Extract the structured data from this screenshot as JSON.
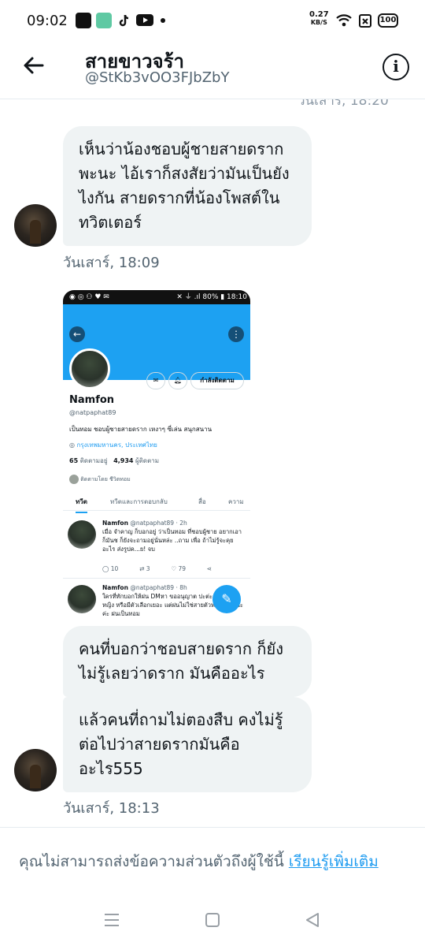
{
  "status_bar": {
    "time": "09:02",
    "speed_value": "0.27",
    "speed_unit": "KB/S",
    "battery": "100"
  },
  "header": {
    "title": "สายขาวจร้า",
    "handle": "@StKb3vOO3FJbZbY",
    "peek_time": "วันเสาร์, 18:20"
  },
  "messages": [
    {
      "text": "เห็นว่าน้องชอบผู้ชายสายดราก พะนะ ไอ้เราก็สงสัยว่ามันเป็นยังไงกัน สายดรากที่น้องโพสต์ในทวิตเตอร์",
      "timestamp": "วันเสาร์, 18:09"
    },
    {
      "text": "คนที่บอกว่าชอบสายดราก ก็ยังไม่รู้เลยว่าดราก มันคืออะไร"
    },
    {
      "text": "แล้วคนที่ถามไม่ตองสืบ คงไม่รู้ต่อไปว่าสายดรากมันคืออะไร555",
      "timestamp": "วันเสาร์, 18:13"
    }
  ],
  "embedded_screenshot": {
    "status_left": "◉ ◎ ⚇ ♥ ✉",
    "status_right": "✕ ⏚ .ıl 80% ▮ 18:10",
    "following_button": "กำลังติดตาม",
    "name": "Namfon",
    "handle": "@natpaphat89",
    "bio": "เป็นทอม ชอบผู้ชายสายดราก เหงาๆ ซี่เล่น สนุกสนาน",
    "location": "กรุงเทพมหานคร, ประเทศไทย",
    "following_count": "65",
    "following_label": "ติดตามอยู่",
    "followers_count": "4,934",
    "followers_label": "ผู้ติดตาม",
    "followed_by": "ติดตามโดย ชีวิตทอม",
    "tabs": [
      "ทวีต",
      "ทวีตและการตอบกลับ",
      "สื่อ",
      "ความ"
    ],
    "tweets": [
      {
        "author": "Namfon",
        "meta": "@natpaphat89 · 2h",
        "text": "เมื่อ จำคาญ ก็บอกอยู่ ว่าเป็นทอม ที่ชอบผู้ชาย อยากเอาก็มันช ก็ยังจะถามอยู่นั่นหล่ะ ..ถาม เพื่อ ถ้าไม่รู้จะคุยอะไร ส่งรูปค...ย! จบ",
        "replies": "10",
        "retweets": "3",
        "likes": "79"
      },
      {
        "author": "Namfon",
        "meta": "@natpaphat89 · 8h",
        "text": "ใครที่ทักบอกให้ฝน DMหา ขออนุญาต ปะต่ะ ไม่ใช่ว่าหญิง หรือมีตัวเลือกเยอะ แต่ฝนไม่ใช่สายตัวหรือขายสินะค่ะ ฝนเป็นทอม"
      }
    ]
  },
  "footer": {
    "note": "คุณไม่สามารถส่งข้อความส่วนตัวถึงผู้ใช้นี้ ",
    "link": "เรียนรู้เพิ่มเติม"
  },
  "icons": {
    "back": "arrow-left-icon",
    "info": "info-icon",
    "nav_recents": "menu-lines-icon",
    "nav_home": "square-icon",
    "nav_back": "triangle-back-icon"
  },
  "colors": {
    "accent": "#1d9bf0",
    "bubble": "#eff3f4",
    "banner": "#1da1f2"
  }
}
